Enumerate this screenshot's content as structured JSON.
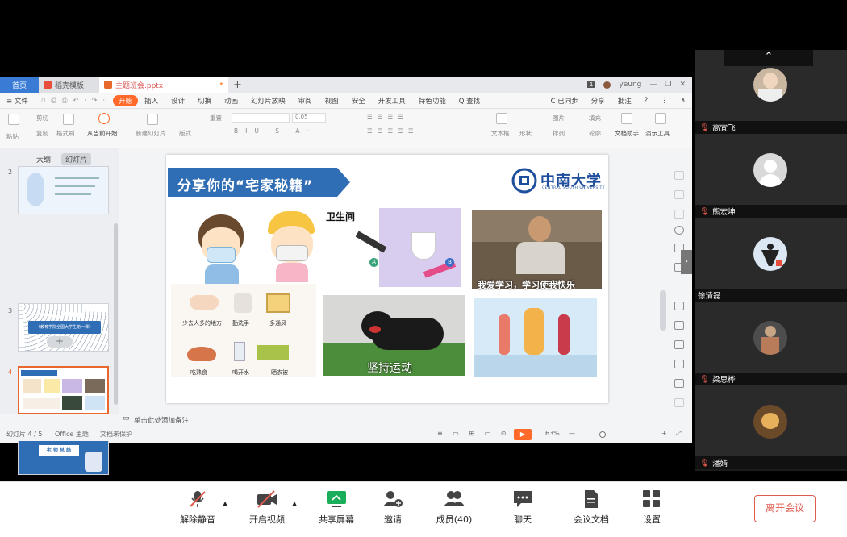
{
  "window": {
    "tabs": [
      {
        "label": "首页"
      },
      {
        "label": "稻壳模板"
      },
      {
        "label": "主题班会.pptx"
      }
    ],
    "user": "yeung"
  },
  "menubar": {
    "items": [
      "≡ 文件",
      "开始",
      "插入",
      "设计",
      "切换",
      "动画",
      "幻灯片放映",
      "审阅",
      "视图",
      "安全",
      "开发工具",
      "特色功能",
      "Q 查找"
    ],
    "right": [
      "C 已同步",
      "分享",
      "批注"
    ]
  },
  "ribbon": {
    "paste": "粘贴",
    "cut": "剪切",
    "copy": "复制",
    "format_painter": "格式刷",
    "play_from_current": "从当前开始",
    "new_slide": "新建幻灯片",
    "layout": "版式",
    "reset": "重置",
    "font_size": "0.05",
    "textbox": "文本框",
    "shape": "形状",
    "picture": "图片",
    "arrange": "排列",
    "fill": "填充",
    "outline": "轮廓",
    "doc_helper": "文档助手",
    "presentation_tools": "演示工具"
  },
  "leftpane": {
    "tab_outline": "大纲",
    "tab_slides": "幻灯片",
    "thumbnails": [
      {
        "num": "2",
        "text": ""
      },
      {
        "num": "3",
        "text": "《教育学院全国大学生第一课》"
      },
      {
        "num": "4",
        "text": ""
      },
      {
        "num": "5",
        "text": "老 师 总 结"
      }
    ]
  },
  "slide": {
    "title": "分享你的“宅家秘籍”",
    "logo_cn": "中南大学",
    "logo_en": "CENTRAL SOUTH UNIVERSITY",
    "bathroom_label": "卫生间",
    "meme_text": "我爱学习，学习使我快乐",
    "exercise_text": "坚持运动",
    "tips": [
      "少去人多的地方",
      "勤洗手",
      "多通风",
      "吃熟食",
      "喝开水",
      "晒衣被"
    ]
  },
  "notes_placeholder": "单击此处添加备注",
  "statusbar": {
    "slide_info": "幻灯片 4 / 5",
    "theme": "Office 主题",
    "doc_status": "文档未保护",
    "zoom": "63%"
  },
  "participants": [
    {
      "name": "高宜飞",
      "muted": true
    },
    {
      "name": "熊宏坤",
      "muted": true
    },
    {
      "name": "徐清磊",
      "muted": false
    },
    {
      "name": "梁思桦",
      "muted": true
    },
    {
      "name": "潘婧",
      "muted": true
    }
  ],
  "toolbar": {
    "unmute": "解除静音",
    "start_video": "开启视频",
    "share_screen": "共享屏幕",
    "invite": "邀请",
    "members": "成员(40)",
    "chat": "聊天",
    "meeting_docs": "会议文档",
    "settings": "设置",
    "leave": "离开会议"
  }
}
